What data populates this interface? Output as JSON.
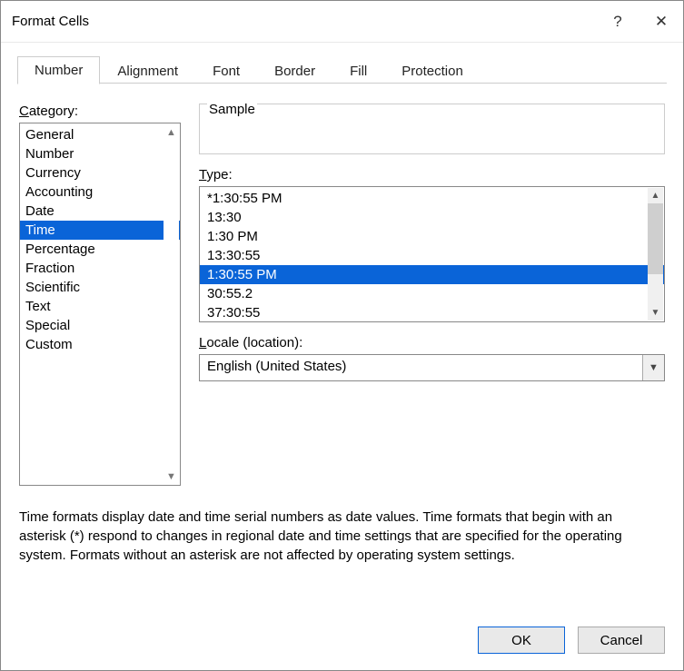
{
  "titlebar": {
    "title": "Format Cells",
    "help_icon": "?",
    "close_icon": "✕"
  },
  "tabs": [
    {
      "label": "Number",
      "active": true
    },
    {
      "label": "Alignment",
      "active": false
    },
    {
      "label": "Font",
      "active": false
    },
    {
      "label": "Border",
      "active": false
    },
    {
      "label": "Fill",
      "active": false
    },
    {
      "label": "Protection",
      "active": false
    }
  ],
  "category": {
    "label": "Category:",
    "items": [
      "General",
      "Number",
      "Currency",
      "Accounting",
      "Date",
      "Time",
      "Percentage",
      "Fraction",
      "Scientific",
      "Text",
      "Special",
      "Custom"
    ],
    "selected_index": 5
  },
  "sample": {
    "label": "Sample",
    "value": ""
  },
  "type": {
    "label": "Type:",
    "items": [
      "*1:30:55 PM",
      "13:30",
      "1:30 PM",
      "13:30:55",
      "1:30:55 PM",
      "30:55.2",
      "37:30:55"
    ],
    "selected_index": 4
  },
  "locale": {
    "label": "Locale (location):",
    "value": "English (United States)"
  },
  "description": "Time formats display date and time serial numbers as date values.  Time formats that begin with an asterisk (*) respond to changes in regional date and time settings that are specified for the operating system. Formats without an asterisk are not affected by operating system settings.",
  "buttons": {
    "ok": "OK",
    "cancel": "Cancel"
  }
}
